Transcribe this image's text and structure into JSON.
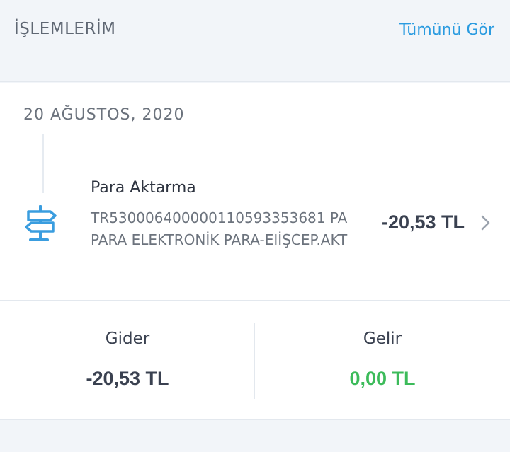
{
  "header": {
    "title": "İŞLEMLERİM",
    "see_all_label": "Tümünü Gör"
  },
  "transactions": {
    "date": "20 AĞUSTOS, 2020",
    "items": [
      {
        "title": "Para Aktarma",
        "description": "TR530006400000110593353681 PAPARA ELEKTRONİK PARA-EIİŞCEP.AKT",
        "amount": "-20,53 TL",
        "icon": "signpost-icon"
      }
    ]
  },
  "summary": {
    "expense_label": "Gider",
    "expense_value": "-20,53 TL",
    "income_label": "Gelir",
    "income_value": "0,00 TL"
  },
  "colors": {
    "accent": "#2a9be0",
    "income": "#3cbb5a",
    "amount": "#3a4150"
  }
}
